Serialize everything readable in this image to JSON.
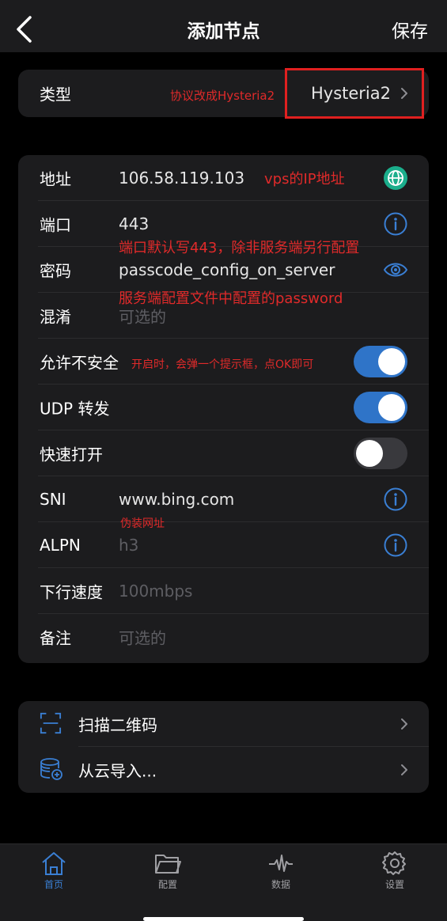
{
  "nav": {
    "title": "添加节点",
    "save": "保存"
  },
  "type_row": {
    "label": "类型",
    "value": "Hysteria2"
  },
  "fields": {
    "address": {
      "label": "地址",
      "value": "106.58.119.103"
    },
    "port": {
      "label": "端口",
      "value": "443"
    },
    "password": {
      "label": "密码",
      "value": "passcode_config_on_server"
    },
    "obfs": {
      "label": "混淆",
      "placeholder": "可选的"
    },
    "insecure": {
      "label": "允许不安全",
      "on": true
    },
    "udp": {
      "label": "UDP 转发",
      "on": true
    },
    "fast_open": {
      "label": "快速打开",
      "on": false
    },
    "sni": {
      "label": "SNI",
      "value": "www.bing.com"
    },
    "alpn": {
      "label": "ALPN",
      "placeholder": "h3"
    },
    "down_speed": {
      "label": "下行速度",
      "placeholder": "100mbps"
    },
    "remark": {
      "label": "备注",
      "placeholder": "可选的"
    }
  },
  "import": {
    "scan": "扫描二维码",
    "cloud": "从云导入..."
  },
  "annotations": {
    "protocol": "协议改成Hysteria2",
    "vps_ip": "vps的IP地址",
    "port": "端口默认写443，除非服务端另行配置",
    "password": "服务端配置文件中配置的password",
    "insecure": "开启时，会弹一个提示框，点OK即可",
    "sni": "伪装网址"
  },
  "tabs": [
    {
      "label": "首页",
      "icon": "home-icon",
      "active": true
    },
    {
      "label": "配置",
      "icon": "folder-icon",
      "active": false
    },
    {
      "label": "数据",
      "icon": "waveform-icon",
      "active": false
    },
    {
      "label": "设置",
      "icon": "gear-icon",
      "active": false
    }
  ],
  "colors": {
    "accent": "#2f74c8",
    "annotation": "#e02a2a",
    "card": "#1c1c1e",
    "background": "#000000"
  }
}
